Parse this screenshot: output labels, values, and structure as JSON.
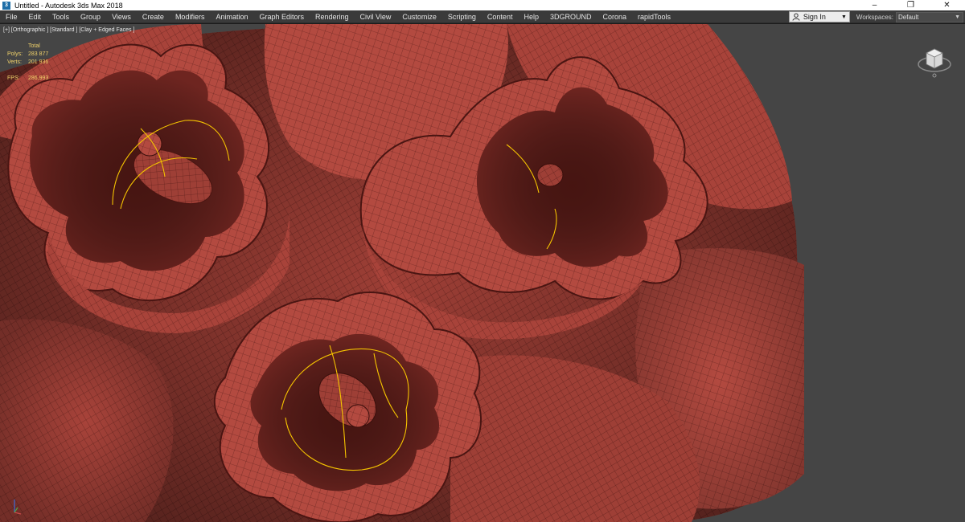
{
  "window": {
    "title": "Untitled - Autodesk 3ds Max 2018",
    "app_icon_glyph": "3",
    "controls": {
      "minimize": "–",
      "restore": "❐",
      "close": "✕"
    }
  },
  "menu": {
    "items": [
      "File",
      "Edit",
      "Tools",
      "Group",
      "Views",
      "Create",
      "Modifiers",
      "Animation",
      "Graph Editors",
      "Rendering",
      "Civil View",
      "Customize",
      "Scripting",
      "Content",
      "Help",
      "3DGROUND",
      "Corona",
      "rapidTools"
    ],
    "sign_in": "Sign In",
    "workspaces_label": "Workspaces:",
    "workspaces_value": "Default"
  },
  "viewport": {
    "label": "[+] [Orthographic ] [Standard ] [Clay + Edged Faces ]",
    "stats": {
      "header": "Total",
      "polys_label": "Polys:",
      "polys_value": "283 877",
      "verts_label": "Verts:",
      "verts_value": "201 936",
      "fps_label": "FPS:",
      "fps_value": "286,993"
    },
    "colors": {
      "background": "#454545",
      "clay": "#b34a40",
      "clay_dark": "#6e2520",
      "selection": "#f5c400",
      "stats_text": "#f2d36b"
    }
  }
}
